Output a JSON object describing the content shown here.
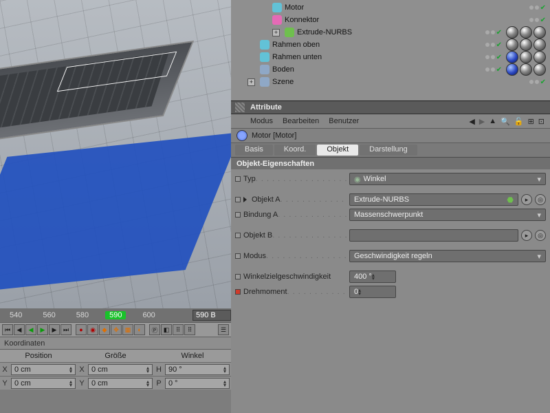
{
  "tree": {
    "items": [
      {
        "label": "Motor",
        "icon": "cyan",
        "indent": 2
      },
      {
        "label": "Konnektor",
        "icon": "pink",
        "indent": 2
      },
      {
        "label": "Extrude-NURBS",
        "icon": "green",
        "indent": 2,
        "plus": true,
        "mats": true
      },
      {
        "label": "Rahmen oben",
        "icon": "cyan",
        "indent": 1,
        "mats": true
      },
      {
        "label": "Rahmen unten",
        "icon": "cyan",
        "indent": 1,
        "mats": true,
        "blue": true
      },
      {
        "label": "Boden",
        "icon": "grid",
        "indent": 1,
        "mats": true,
        "blue": true
      },
      {
        "label": "Szene",
        "icon": "grid",
        "indent": 0,
        "plus": true
      }
    ]
  },
  "attributes": {
    "panel_title": "Attribute",
    "menu": {
      "modus": "Modus",
      "bearbeiten": "Bearbeiten",
      "benutzer": "Benutzer"
    },
    "obj_label": "Motor [Motor]",
    "tabs": {
      "basis": "Basis",
      "koord": "Koord.",
      "objekt": "Objekt",
      "darstellung": "Darstellung"
    },
    "section": "Objekt-Eigenschaften",
    "rows": {
      "typ": {
        "label": "Typ",
        "value": "Winkel"
      },
      "objA": {
        "label": "Objekt A",
        "value": "Extrude-NURBS"
      },
      "bindA": {
        "label": "Bindung A",
        "value": "Massenschwerpunkt"
      },
      "objB": {
        "label": "Objekt B",
        "value": ""
      },
      "modus": {
        "label": "Modus",
        "value": "Geschwindigkeit regeln"
      },
      "wziel": {
        "label": "Winkelzielgeschwindigkeit",
        "value": "400 °"
      },
      "drehm": {
        "label": "Drehmoment",
        "value": "0"
      }
    }
  },
  "timeline": {
    "ticks": [
      "540",
      "560",
      "580",
      "590",
      "600"
    ],
    "current": "590",
    "frame_display": "590 B"
  },
  "coords": {
    "title": "Koordinaten",
    "cols": {
      "pos": "Position",
      "size": "Größe",
      "angle": "Winkel"
    },
    "row1": {
      "x": "0 cm",
      "y": "0 cm",
      "h": "90 °"
    },
    "row2": {
      "x2": "0 cm",
      "y2": "0 cm",
      "p": "0 °"
    }
  }
}
